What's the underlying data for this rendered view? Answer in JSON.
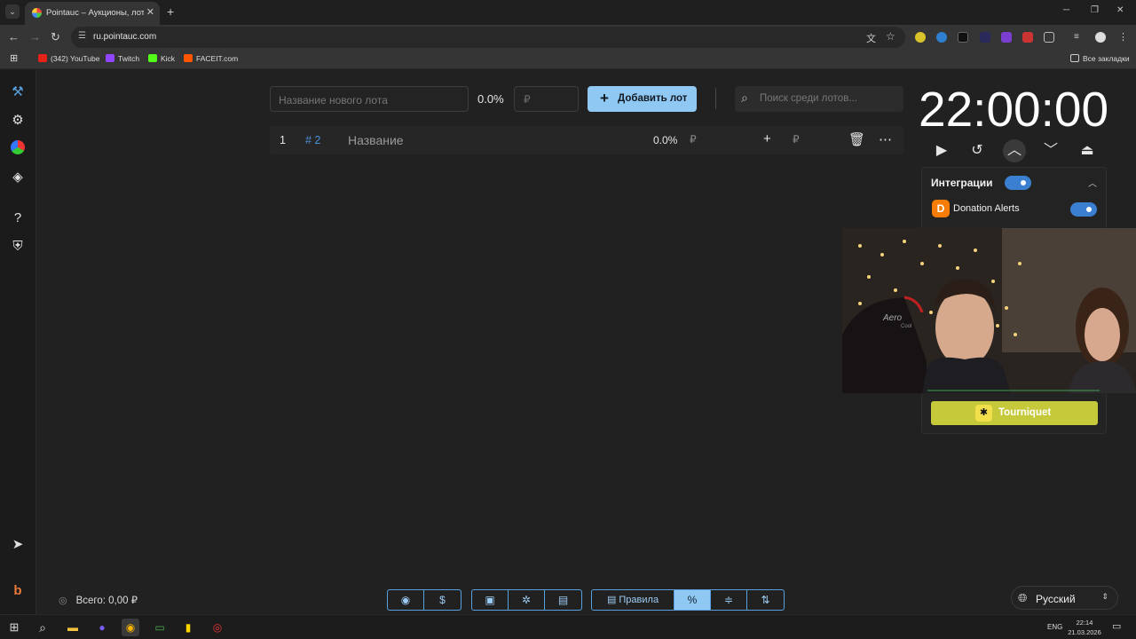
{
  "browser": {
    "tab_title": "Pointauc – Аукционы, лотереи",
    "url": "ru.pointauc.com",
    "bookmarks": [
      "(342) YouTube",
      "Twitch",
      "Kick",
      "FACEIT.com"
    ],
    "all_bookmarks": "Все закладки"
  },
  "lot_form": {
    "name_placeholder": "Название нового лота",
    "percent": "0.0%",
    "amount_placeholder": "₽",
    "add_button": "Добавить лот",
    "search_placeholder": "Поиск среди лотов..."
  },
  "lots": [
    {
      "num": "1",
      "id": "# 2",
      "name": "Название",
      "percent": "0.0%",
      "currency": "₽"
    }
  ],
  "timer": {
    "value": "22:00:00"
  },
  "integrations": {
    "title": "Интеграции",
    "enabled": true,
    "donation_alerts": "Donation Alerts",
    "tourniquet": "Tourniquet"
  },
  "footer": {
    "total": "Всего: 0,00 ₽",
    "rules": "Правила",
    "language": "Русский"
  },
  "taskbar": {
    "lang": "ENG",
    "time": "22:14",
    "date": "21.03.2026"
  },
  "colors": {
    "accent": "#90c8f4",
    "toggle": "#3b7fd1",
    "tourniquet": "#c5c93a",
    "lot_id": "#4a90d9"
  }
}
